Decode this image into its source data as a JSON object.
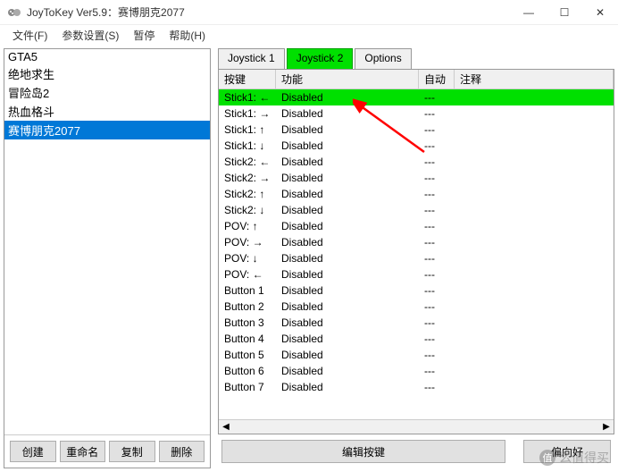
{
  "window": {
    "title": "JoyToKey Ver5.9：赛博朋克2077",
    "minimize": "—",
    "maximize": "☐",
    "close": "✕"
  },
  "menu": {
    "file": "文件(F)",
    "settings": "参数设置(S)",
    "pause": "暂停",
    "help": "帮助(H)"
  },
  "profiles": {
    "items": [
      "GTA5",
      "绝地求生",
      "冒险岛2",
      "热血格斗",
      "赛博朋克2077"
    ],
    "selected_index": 4
  },
  "profile_buttons": {
    "create": "创建",
    "rename": "重命名",
    "copy": "复制",
    "delete": "删除"
  },
  "tabs": {
    "items": [
      "Joystick 1",
      "Joystick 2",
      "Options"
    ],
    "active_index": 1
  },
  "columns": {
    "button": "按键",
    "function": "功能",
    "auto": "自动",
    "note": "注释"
  },
  "mappings": [
    {
      "btn": "Stick1: ←",
      "fn": "Disabled",
      "auto": "---",
      "note": ""
    },
    {
      "btn": "Stick1: →",
      "fn": "Disabled",
      "auto": "---",
      "note": ""
    },
    {
      "btn": "Stick1: ↑",
      "fn": "Disabled",
      "auto": "---",
      "note": ""
    },
    {
      "btn": "Stick1: ↓",
      "fn": "Disabled",
      "auto": "---",
      "note": ""
    },
    {
      "btn": "Stick2: ←",
      "fn": "Disabled",
      "auto": "---",
      "note": ""
    },
    {
      "btn": "Stick2: →",
      "fn": "Disabled",
      "auto": "---",
      "note": ""
    },
    {
      "btn": "Stick2: ↑",
      "fn": "Disabled",
      "auto": "---",
      "note": ""
    },
    {
      "btn": "Stick2: ↓",
      "fn": "Disabled",
      "auto": "---",
      "note": ""
    },
    {
      "btn": "POV: ↑",
      "fn": "Disabled",
      "auto": "---",
      "note": ""
    },
    {
      "btn": "POV: →",
      "fn": "Disabled",
      "auto": "---",
      "note": ""
    },
    {
      "btn": "POV: ↓",
      "fn": "Disabled",
      "auto": "---",
      "note": ""
    },
    {
      "btn": "POV: ←",
      "fn": "Disabled",
      "auto": "---",
      "note": ""
    },
    {
      "btn": "Button 1",
      "fn": "Disabled",
      "auto": "---",
      "note": ""
    },
    {
      "btn": "Button 2",
      "fn": "Disabled",
      "auto": "---",
      "note": ""
    },
    {
      "btn": "Button 3",
      "fn": "Disabled",
      "auto": "---",
      "note": ""
    },
    {
      "btn": "Button 4",
      "fn": "Disabled",
      "auto": "---",
      "note": ""
    },
    {
      "btn": "Button 5",
      "fn": "Disabled",
      "auto": "---",
      "note": ""
    },
    {
      "btn": "Button 6",
      "fn": "Disabled",
      "auto": "---",
      "note": ""
    },
    {
      "btn": "Button 7",
      "fn": "Disabled",
      "auto": "---",
      "note": ""
    }
  ],
  "selected_row": 0,
  "bottom": {
    "edit": "编辑按键",
    "prefs": "偏向好"
  },
  "watermark": "么值得买"
}
